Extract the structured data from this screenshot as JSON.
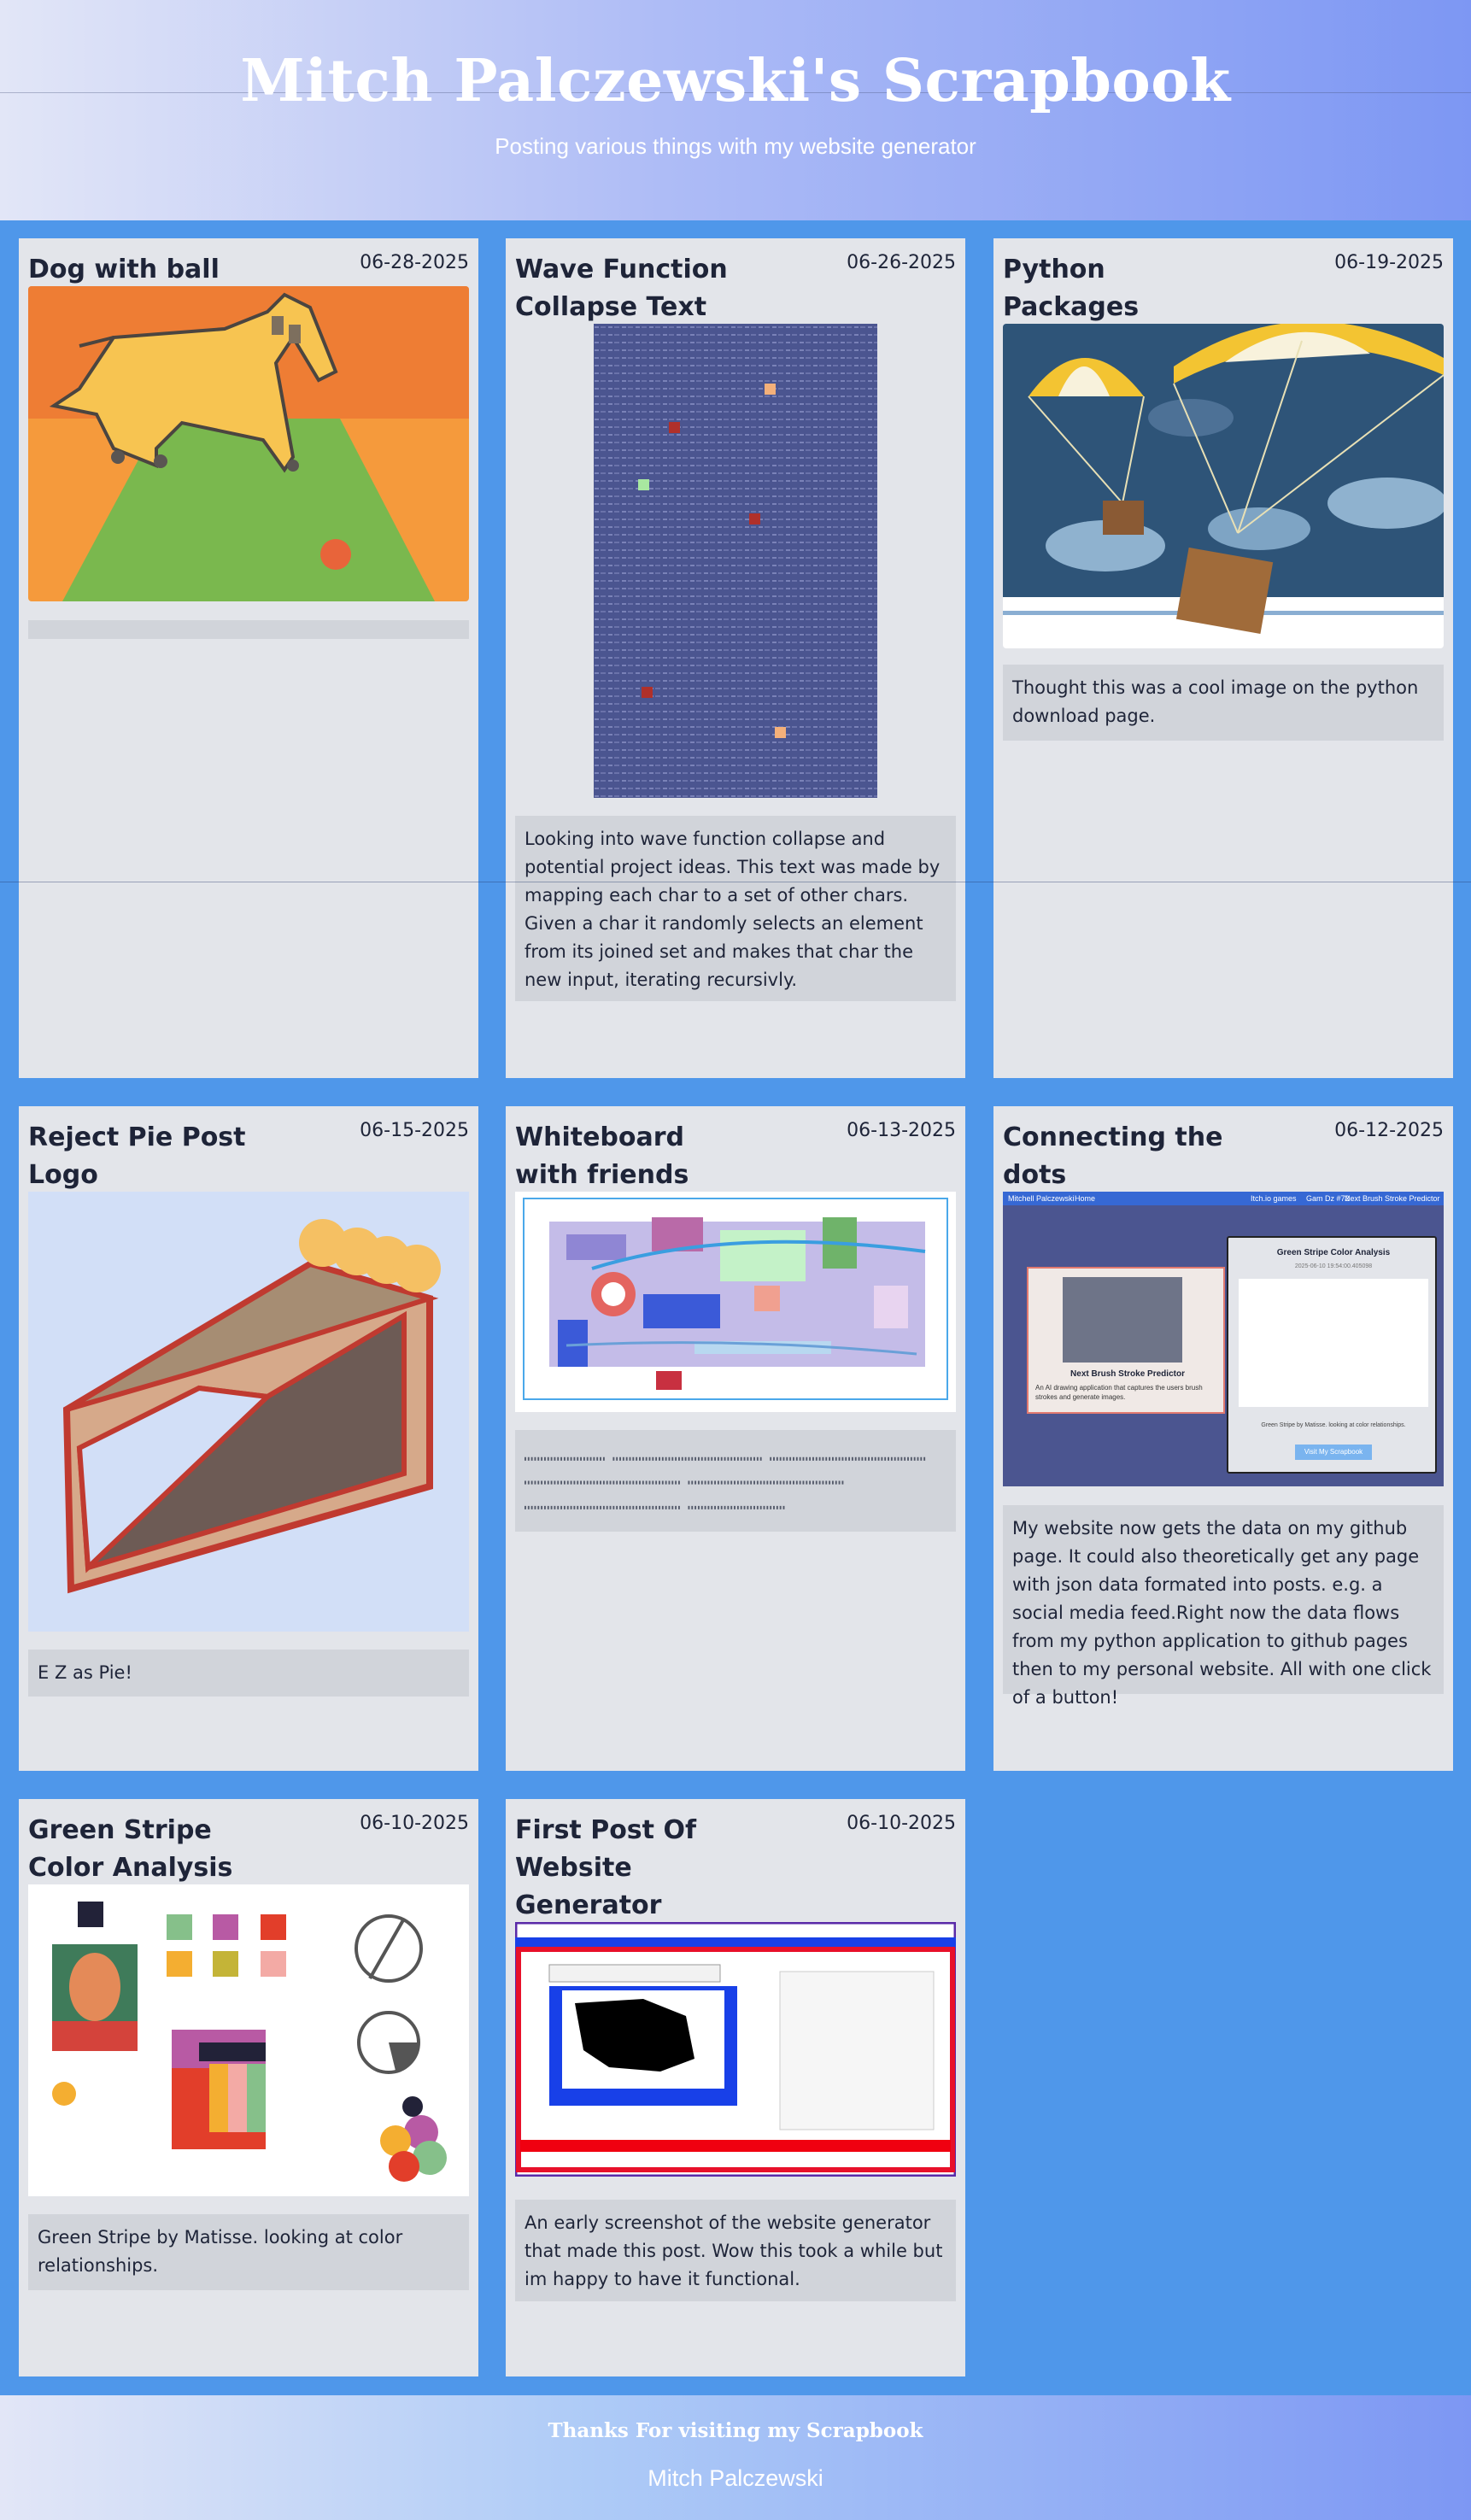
{
  "site": {
    "title": "Mitch Palczewski's Scrapbook",
    "subtitle": "Posting various things with my website generator"
  },
  "posts": [
    {
      "title": "Dog with ball",
      "date": "06-28-2025",
      "description": "",
      "image": "dog-with-ball-drawing"
    },
    {
      "title": "Wave Function Collapse Text",
      "date": "06-26-2025",
      "description": "Looking into wave function collapse and potential project ideas. This text was made by mapping each char to a set of other chars. Given a char it randomly selects an element from its joined set and makes that char the new input, iterating recursivly.",
      "image": "wave-function-collapse-text"
    },
    {
      "title": "Python Packages",
      "date": "06-19-2025",
      "description": "Thought this was a cool image on the python download page.",
      "image": "parachute-packages"
    },
    {
      "title": "Reject Pie Post Logo",
      "date": "06-15-2025",
      "description": "E Z as Pie!",
      "image": "pie-logo"
    },
    {
      "title": "Whiteboard with friends",
      "date": "06-13-2025",
      "description": "",
      "image": "whiteboard-drawing"
    },
    {
      "title": "Connecting the dots",
      "date": "06-12-2025",
      "description": "My website now gets the data on my github page. It could also theoretically get any page with json data formated into posts. e.g. a social media feed.Right now the data flows from my python application to github pages then to my personal website. All with one click of a button!",
      "image": "website-screenshot"
    },
    {
      "title": "Green Stripe Color Analysis",
      "date": "06-10-2025",
      "description": "Green Stripe by Matisse. looking at color relationships.",
      "image": "color-analysis"
    },
    {
      "title": "First Post Of Website Generator",
      "date": "06-10-2025",
      "description": "An early screenshot of the website generator that made this post. Wow this took a while but im happy to have it functional.",
      "image": "generator-screenshot"
    }
  ],
  "embedded": {
    "cta_nav": [
      "Mitchell Palczewski",
      "Home",
      "Itch.io games",
      "Gam Dz #72",
      "Next Brush Stroke Predictor"
    ],
    "cta_card_title": "Green Stripe Color Analysis",
    "cta_card_date": "2025-06-10 19:54:00.405098",
    "cta_card_caption": "Green Stripe by Matisse. looking at color relationships.",
    "cta_card_button": "Visit My Scrapbook",
    "brush_title": "Next Brush Stroke Predictor",
    "brush_desc": "An AI drawing application that captures the users brush strokes and generate images."
  },
  "footer": {
    "thanks": "Thanks For visiting my Scrapbook",
    "name": "Mitch Palczewski"
  },
  "colors": {
    "page_bg": "#4f97ea",
    "card_bg": "#e3e5ea",
    "desc_bg": "#d1d4da",
    "text": "#1e2438"
  }
}
